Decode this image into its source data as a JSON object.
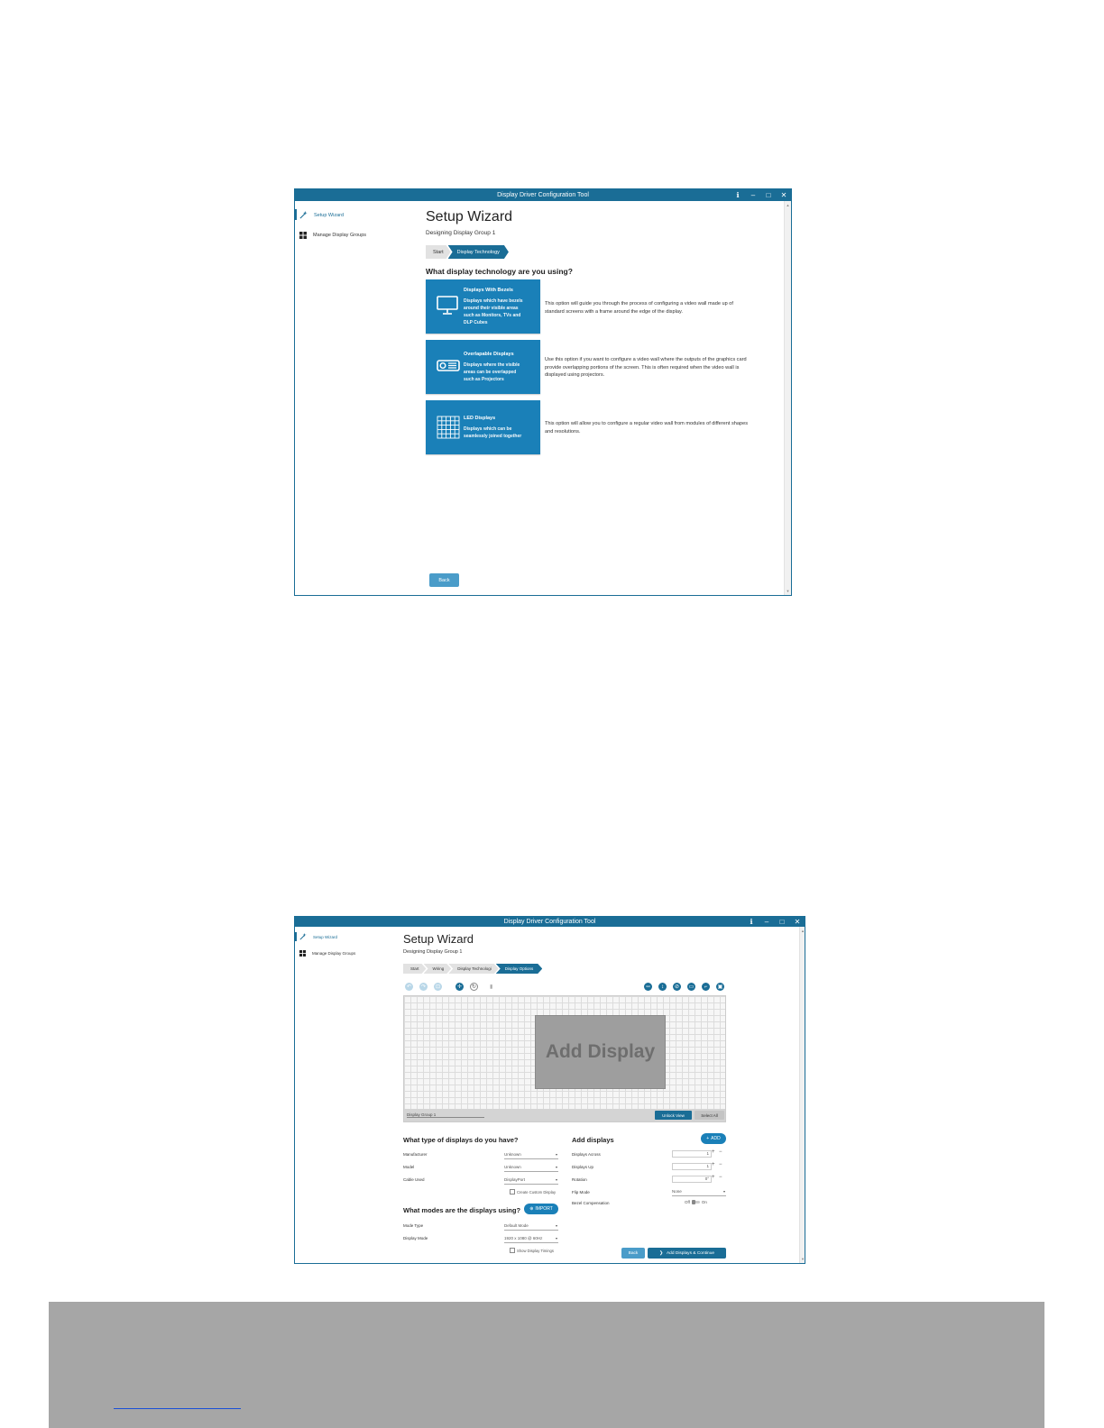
{
  "screen1": {
    "title": "Display Driver Configuration Tool",
    "window_controls": {
      "info": "ℹ",
      "minimize": "–",
      "maximize": "□",
      "close": "✕"
    },
    "sidebar": {
      "items": [
        {
          "label": "Setup Wizard"
        },
        {
          "label": "Manage Display Groups"
        }
      ]
    },
    "heading": "Setup Wizard",
    "subheading": "Designing Display Group 1",
    "breadcrumbs": [
      "Start",
      "Display Technology"
    ],
    "question": "What display technology are you using?",
    "options": [
      {
        "title": "Displays With Bezels",
        "desc": [
          "Displays which have bezels",
          "around their visible areas",
          "such as Monitors, TVs and",
          "DLP Cubes"
        ],
        "explain": [
          "This option will guide you through the process of configuring a video wall made up of",
          "standard screens with a frame around the edge of the display."
        ]
      },
      {
        "title": "Overlapable Displays",
        "desc": [
          "Displays where the visible",
          "areas can be overlapped",
          "such as Projectors"
        ],
        "explain": [
          "Use this option if you want to configure a video wall where the outputs of the graphics card",
          "provide overlapping portions of the screen. This is often required when the video wall is",
          "displayed using projectors."
        ]
      },
      {
        "title": "LED Displays",
        "desc": [
          "Displays which can be",
          "seamlessly joined together"
        ],
        "explain": [
          "This option will allow you to configure a regular video wall from modules of different shapes",
          "and resolutions."
        ]
      }
    ],
    "back_label": "Back"
  },
  "screen2": {
    "title": "Display Driver Configuration Tool",
    "window_controls": {
      "info": "ℹ",
      "minimize": "–",
      "maximize": "□",
      "close": "✕"
    },
    "sidebar": {
      "items": [
        {
          "label": "Setup Wizard"
        },
        {
          "label": "Manage Display Groups"
        }
      ]
    },
    "heading": "Setup Wizard",
    "subheading": "Designing Display Group 1",
    "breadcrumbs": [
      "Start",
      "Wiring",
      "Display Technologi",
      "Display Options"
    ],
    "canvas": {
      "add_display": "Add Display",
      "group_name": "Display Group 1",
      "unlock_view": "Unlock View",
      "select_all": "Select All"
    },
    "types": {
      "title": "What type of displays do you have?",
      "rows": [
        {
          "label": "Manufacturer",
          "value": "Unknown"
        },
        {
          "label": "Model",
          "value": "Unknown"
        },
        {
          "label": "Cable Used",
          "value": "DisplayPort"
        }
      ],
      "custom_checkbox": "Create Custom Display"
    },
    "modes": {
      "title": "What modes are the displays using?",
      "import_label": "IMPORT",
      "rows": [
        {
          "label": "Mode Type",
          "value": "Default Mode"
        },
        {
          "label": "Display Mode",
          "value": "1920 x 1080 @ 60Hz"
        }
      ],
      "timings_checkbox": "Show Display Timings"
    },
    "add": {
      "title": "Add displays",
      "add_label": "ADD",
      "rows": [
        {
          "label": "Displays Across",
          "value": "1"
        },
        {
          "label": "Displays Up",
          "value": "1"
        },
        {
          "label": "Rotation",
          "value": "0°"
        }
      ],
      "flip_label": "Flip Mode",
      "flip_value": "None",
      "bezel_label": "Bezel Compensation",
      "bezel_off": "Off",
      "bezel_on": "On"
    },
    "back_label": "Back",
    "continue_label": "Add Displays & Continue"
  }
}
